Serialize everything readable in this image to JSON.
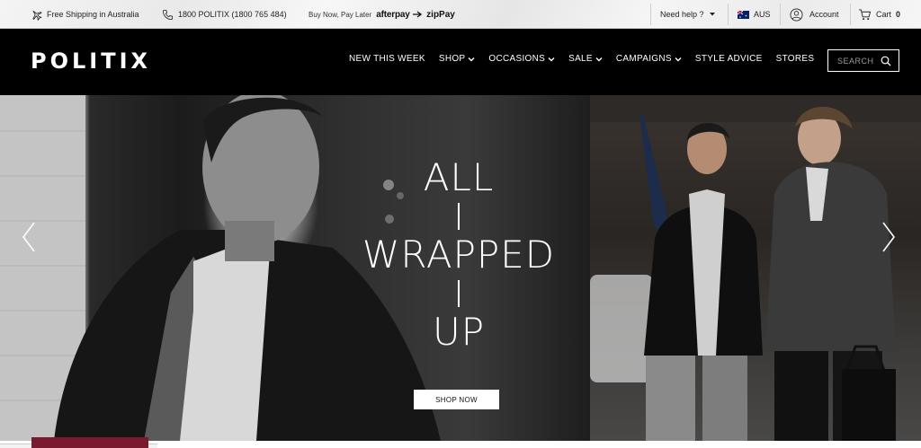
{
  "utility": {
    "shipping_text": "Free Shipping in Australia",
    "phone_text": "1800 POLITIX (1800 765 484)",
    "bnpl_text": "Buy Now, Pay Later",
    "afterpay": "afterpay",
    "zippay": "zipPay",
    "help_text": "Need help ?",
    "country": "AUS",
    "account": "Account",
    "cart_label": "Cart",
    "cart_count": "0"
  },
  "nav": {
    "logo": "POLITIX",
    "items": [
      {
        "label": "NEW THIS WEEK",
        "dropdown": false
      },
      {
        "label": "SHOP",
        "dropdown": true
      },
      {
        "label": "OCCASIONS",
        "dropdown": true
      },
      {
        "label": "SALE",
        "dropdown": true
      },
      {
        "label": "CAMPAIGNS",
        "dropdown": true
      },
      {
        "label": "STYLE ADVICE",
        "dropdown": false
      },
      {
        "label": "STORES",
        "dropdown": false
      }
    ],
    "search_placeholder": "SEARCH"
  },
  "hero": {
    "headline_lines": [
      "ALL",
      "WRAPPED",
      "UP"
    ],
    "cta": "SHOP NOW"
  },
  "colors": {
    "nav_bg": "#000000",
    "promo_accent": "#7a1a2e"
  }
}
